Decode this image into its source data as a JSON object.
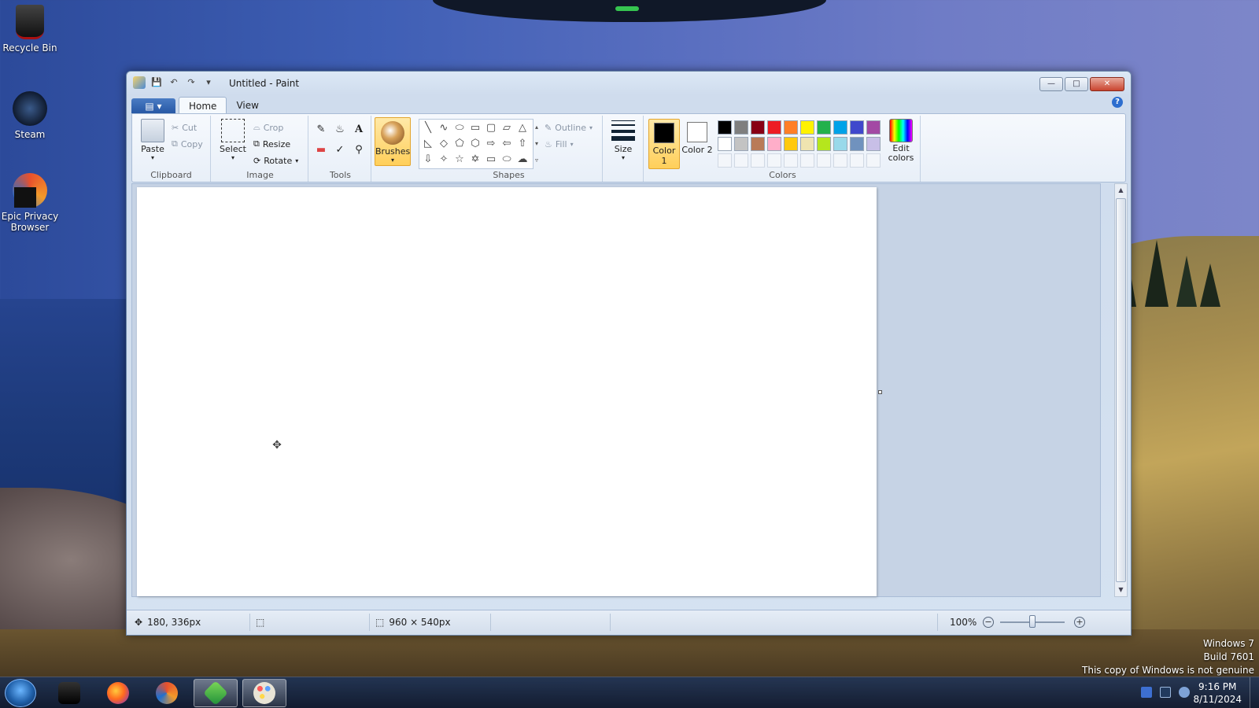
{
  "desktop": {
    "icons": [
      {
        "label": "Recycle Bin"
      },
      {
        "label": "Steam"
      },
      {
        "label": "Epic Privacy Browser"
      }
    ]
  },
  "watermark": {
    "line1": "Windows 7",
    "line2": "Build 7601",
    "line3": "This copy of Windows is not genuine"
  },
  "window": {
    "title": "Untitled - Paint"
  },
  "tabs": {
    "home": "Home",
    "view": "View"
  },
  "ribbon": {
    "clipboard": {
      "label": "Clipboard",
      "paste": "Paste",
      "cut": "Cut",
      "copy": "Copy"
    },
    "image": {
      "label": "Image",
      "select": "Select",
      "crop": "Crop",
      "resize": "Resize",
      "rotate": "Rotate"
    },
    "tools": {
      "label": "Tools"
    },
    "brushes": {
      "label": "Brushes"
    },
    "shapes": {
      "label": "Shapes",
      "outline": "Outline",
      "fill": "Fill"
    },
    "size": {
      "label": "Size"
    },
    "colors": {
      "label": "Colors",
      "color1": "Color 1",
      "color2": "Color 2",
      "edit": "Edit colors",
      "color1_value": "#000000",
      "color2_value": "#ffffff",
      "palette_row1": [
        "#000000",
        "#7f7f7f",
        "#880015",
        "#ed1c24",
        "#ff7f27",
        "#fff200",
        "#22b14c",
        "#00a2e8",
        "#3f48cc",
        "#a349a4"
      ],
      "palette_row2": [
        "#ffffff",
        "#c3c3c3",
        "#b97a57",
        "#ffaec9",
        "#ffc90e",
        "#efe4b0",
        "#b5e61d",
        "#99d9ea",
        "#7092be",
        "#c8bfe7"
      ]
    }
  },
  "status": {
    "cursor_pos": "180, 336px",
    "canvas_size": "960 × 540px",
    "zoom": "100%",
    "zoom_level": 0.5
  },
  "taskbar": {
    "time": "9:16 PM",
    "date": "8/11/2024"
  }
}
